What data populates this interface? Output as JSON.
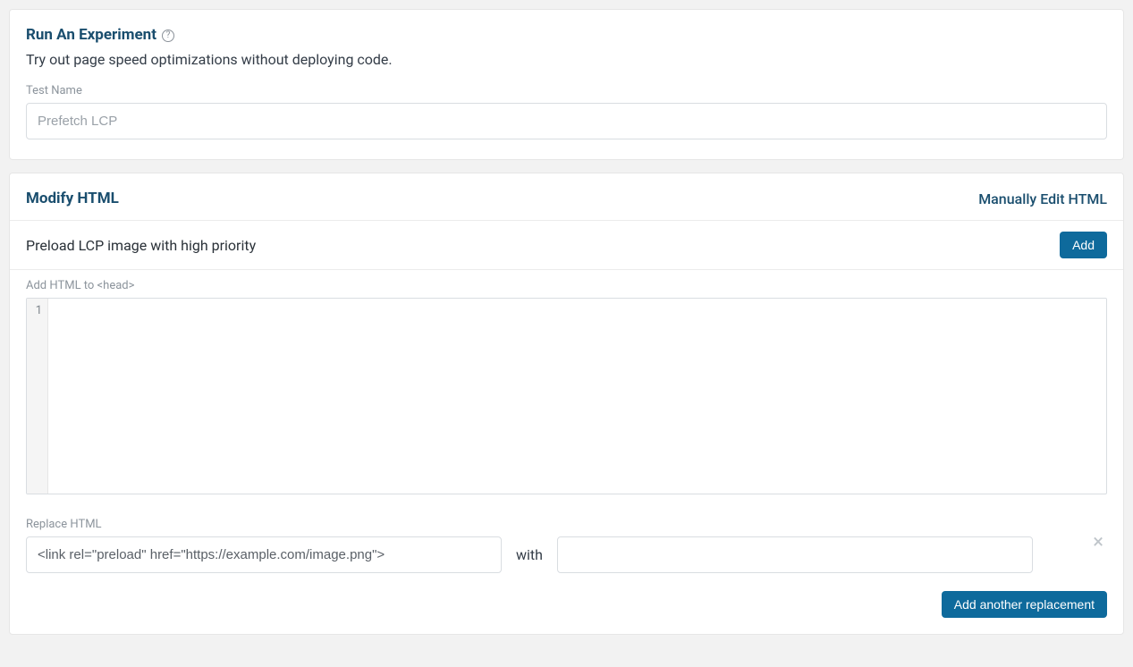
{
  "experiment": {
    "title": "Run An Experiment",
    "help_glyph": "?",
    "subtitle": "Try out page speed optimizations without deploying code.",
    "test_name_label": "Test Name",
    "test_name_placeholder": "Prefetch LCP",
    "test_name_value": ""
  },
  "modify": {
    "title": "Modify HTML",
    "manual_edit_link": "Manually Edit HTML",
    "preload_label": "Preload LCP image with high priority",
    "add_button": "Add",
    "add_html_label": "Add HTML to <head>",
    "editor_gutter_line": "1",
    "editor_content": "",
    "replace_label": "Replace HTML",
    "replace_source_value": "<link rel=\"preload\" href=\"https://example.com/image.png\">",
    "with_label": "with",
    "replace_target_value": "",
    "close_glyph": "×",
    "add_replacement_button": "Add another replacement"
  }
}
